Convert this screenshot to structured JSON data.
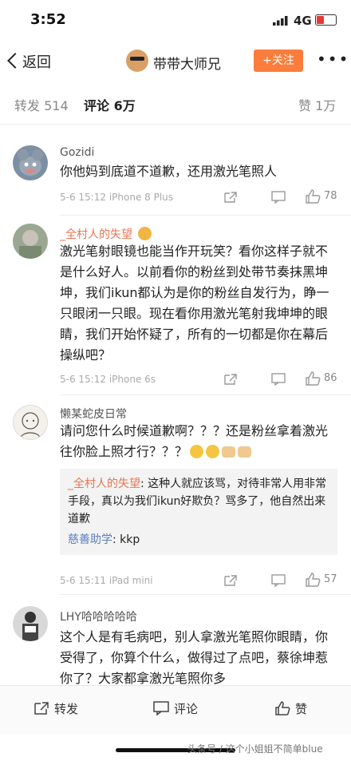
{
  "status_bar": {
    "time": "3:52",
    "network": "4G"
  },
  "nav": {
    "back_label": "返回",
    "title": "带带大师兄",
    "follow_label": "+关注",
    "more_label": "•••"
  },
  "tabs": {
    "repost_label": "转发",
    "repost_count": "514",
    "comment_label": "评论",
    "comment_count": "6万",
    "like_label": "赞",
    "like_count": "1万"
  },
  "comments": [
    {
      "name": "Gozidi",
      "text": "你他妈到底道不道歉，还用激光笔照人",
      "time": "5-6 15:12",
      "device": "iPhone 8 Plus",
      "likes": "78"
    },
    {
      "name": "_全村人的失望",
      "text": "激光笔射眼镜也能当作开玩笑？看你这样子就不是什么好人。以前看你的粉丝到处带节奏抹黑坤坤，我们ikun都认为是你的粉丝自发行为，睁一只眼闭一只眼。现在看你用激光笔射我坤坤的眼睛，我们开始怀疑了，所有的一切都是你在幕后操纵吧？",
      "time": "5-6 15:12",
      "device": "iPhone 6s",
      "likes": "86"
    },
    {
      "name": "懒某蛇皮日常",
      "text": "请问您什么时候道歉啊？？？还是粉丝拿着激光往你脸上照才行？？？",
      "time": "5-6 15:11",
      "device": "iPad mini",
      "likes": "57",
      "replies": [
        {
          "name": "_全村人的失望",
          "text": ": 这种人就应该骂，对待非常人用非常手段，真以为我们ikun好欺负？骂多了，他自然出来道歉"
        },
        {
          "name": "慈善助学",
          "text": ": kkp"
        }
      ]
    },
    {
      "name": "LHY哈哈哈哈哈",
      "text": "这个人是有毛病吧，别人拿激光笔照你眼睛，你受得了，你算个什么，做得过了点吧，蔡徐坤惹你了？大家都拿激光笔照你多"
    }
  ],
  "bottom_bar": {
    "repost": "转发",
    "comment": "评论",
    "like": "赞"
  },
  "watermark": "头条号 / 这个小姐姐不简单blue",
  "colors": {
    "accent": "#fa7d3c",
    "vip_name": "#eb7350",
    "link_name": "#5a7fbf"
  }
}
